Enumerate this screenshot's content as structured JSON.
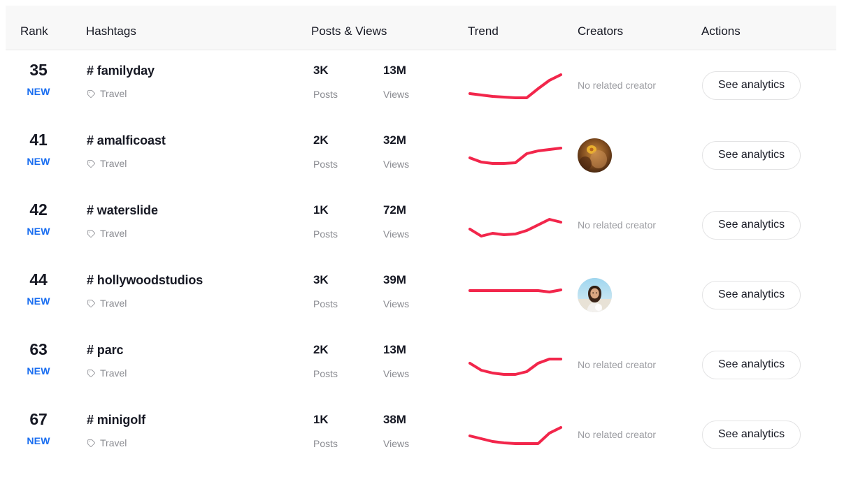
{
  "table": {
    "columns": [
      {
        "key": "rank",
        "label": "Rank"
      },
      {
        "key": "hashtags",
        "label": "Hashtags"
      },
      {
        "key": "posts",
        "label": "Posts & Views"
      },
      {
        "key": "trend",
        "label": "Trend"
      },
      {
        "key": "creators",
        "label": "Creators"
      },
      {
        "key": "actions",
        "label": "Actions"
      }
    ],
    "colors": {
      "trend_line": "#f2264b",
      "new_badge": "#1a6ef0",
      "header_bg": "#f8f8f8",
      "primary_text": "#161823",
      "muted_text": "#8a8b91",
      "button_border": "#e3e3e4"
    },
    "labels": {
      "posts": "Posts",
      "views": "Views",
      "new_badge": "NEW",
      "no_creator": "No related creator",
      "see_analytics": "See analytics",
      "category_icon": "tag-icon"
    },
    "rows": [
      {
        "rank": "35",
        "badge": "NEW",
        "hashtag": "# familyday",
        "category": "Travel",
        "posts": "3K",
        "views": "13M",
        "posts_label": "Posts",
        "views_label": "Views",
        "creator": "No related creator",
        "has_creator": false,
        "action": "See analytics",
        "trend": [
          44,
          46,
          48,
          49,
          50,
          50,
          37,
          25,
          17
        ]
      },
      {
        "rank": "41",
        "badge": "NEW",
        "hashtag": "# amalficoast",
        "category": "Travel",
        "posts": "2K",
        "views": "32M",
        "posts_label": "Posts",
        "views_label": "Views",
        "creator": "",
        "has_creator": true,
        "creator_avatar": "avatar-warm-portrait",
        "action": "See analytics",
        "trend": [
          36,
          42,
          44,
          44,
          43,
          30,
          26,
          24,
          22
        ]
      },
      {
        "rank": "42",
        "badge": "NEW",
        "hashtag": "# waterslide",
        "category": "Travel",
        "posts": "1K",
        "views": "72M",
        "posts_label": "Posts",
        "views_label": "Views",
        "creator": "No related creator",
        "has_creator": false,
        "action": "See analytics",
        "trend": [
          38,
          48,
          44,
          46,
          45,
          40,
          32,
          24,
          28
        ]
      },
      {
        "rank": "44",
        "badge": "NEW",
        "hashtag": "# hollywoodstudios",
        "category": "Travel",
        "posts": "3K",
        "views": "39M",
        "posts_label": "Posts",
        "views_label": "Views",
        "creator": "",
        "has_creator": true,
        "creator_avatar": "avatar-person-outdoors",
        "action": "See analytics",
        "trend": [
          26,
          26,
          26,
          26,
          26,
          26,
          26,
          28,
          25
        ]
      },
      {
        "rank": "63",
        "badge": "NEW",
        "hashtag": "# parc",
        "category": "Travel",
        "posts": "2K",
        "views": "13M",
        "posts_label": "Posts",
        "views_label": "Views",
        "creator": "No related creator",
        "has_creator": false,
        "action": "See analytics",
        "trend": [
          30,
          40,
          44,
          46,
          46,
          42,
          30,
          24,
          24
        ]
      },
      {
        "rank": "67",
        "badge": "NEW",
        "hashtag": "# minigolf",
        "category": "Travel",
        "posts": "1K",
        "views": "38M",
        "posts_label": "Posts",
        "views_label": "Views",
        "creator": "No related creator",
        "has_creator": false,
        "action": "See analytics",
        "trend": [
          34,
          38,
          42,
          44,
          45,
          45,
          45,
          30,
          22
        ]
      }
    ]
  }
}
